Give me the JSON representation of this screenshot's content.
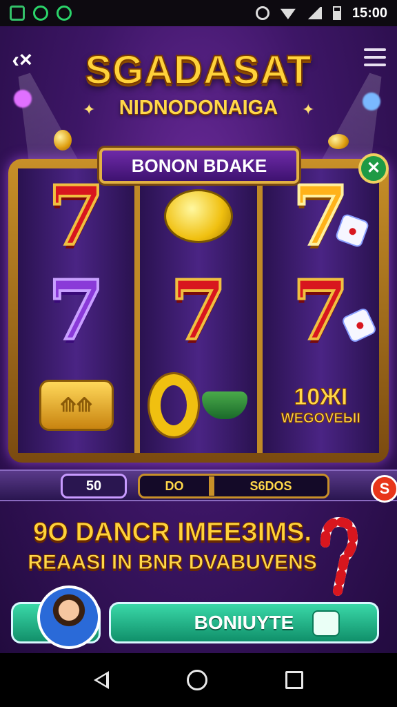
{
  "status_bar": {
    "time": "15:00"
  },
  "game": {
    "title": "SGADASAT",
    "subtitle": "NIDNODONAIGA",
    "reel_banner": "BONON BDAKE",
    "reels": [
      [
        "7",
        "7",
        "drum"
      ],
      [
        "lemon",
        "7",
        "o-ring"
      ],
      [
        "7",
        "7",
        "win"
      ]
    ],
    "win_text_line1": "10ЖI",
    "win_text_line2": "WEGOVEЫI",
    "bet_value": "50",
    "total_left": "DO",
    "total_right": "S6DOS",
    "promo_line1": "9O DANCR IMEEЗIMS.",
    "promo_line2": "REAASI IN BNR DVABUVENS",
    "play_button_label": "BONIUYTE"
  },
  "colors": {
    "accent": "#ffd23a",
    "button": "#22b888",
    "background": "#3d1666"
  },
  "icons": {
    "back": "back-arrow-icon",
    "menu": "hamburger-icon",
    "home": "home-circle-icon",
    "recents": "square-icon"
  }
}
